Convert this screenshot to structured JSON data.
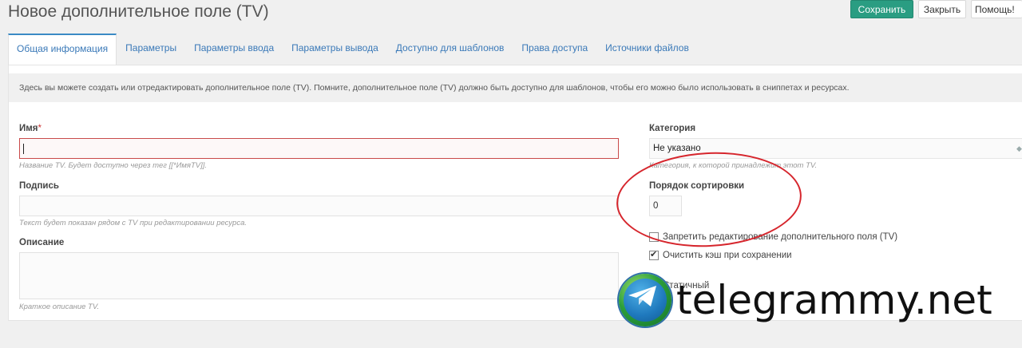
{
  "page": {
    "title": "Новое дополнительное поле (TV)"
  },
  "toolbar": {
    "save_label": "Сохранить",
    "close_label": "Закрыть",
    "help_label": "Помощь!"
  },
  "tabs": [
    {
      "label": "Общая информация",
      "active": true
    },
    {
      "label": "Параметры"
    },
    {
      "label": "Параметры ввода"
    },
    {
      "label": "Параметры вывода"
    },
    {
      "label": "Доступно для шаблонов"
    },
    {
      "label": "Права доступа"
    },
    {
      "label": "Источники файлов"
    }
  ],
  "notice": "Здесь вы можете создать или отредактировать дополнительное поле (TV). Помните, дополнительное поле (TV) должно быть доступно для шаблонов, чтобы его можно было использовать в сниппетах и ресурсах.",
  "form": {
    "name": {
      "label": "Имя",
      "required_mark": "*",
      "value": "",
      "hint": "Название TV. Будет доступно через тег [[*ИмяTV]]."
    },
    "caption": {
      "label": "Подпись",
      "value": "",
      "hint": "Текст будет показан рядом с TV при редактировании ресурса."
    },
    "description": {
      "label": "Описание",
      "value": "",
      "hint": "Краткое описание TV."
    },
    "category": {
      "label": "Категория",
      "value": "Не указано",
      "hint": "Категория, к которой принадлежит этот TV."
    },
    "rank": {
      "label": "Порядок сортировки",
      "value": "0"
    },
    "lock": {
      "label": "Запретить редактирование дополнительного поля (TV)",
      "checked": false
    },
    "clear_cache": {
      "label": "Очистить кэш при сохранении",
      "checked": true
    },
    "static_partial": "Статичный"
  },
  "watermark": {
    "text": "telegrammy.net"
  },
  "colors": {
    "primary": "#2a9d82",
    "link": "#3a79b8",
    "error": "#c94a4a",
    "annotation": "#d6262d"
  }
}
